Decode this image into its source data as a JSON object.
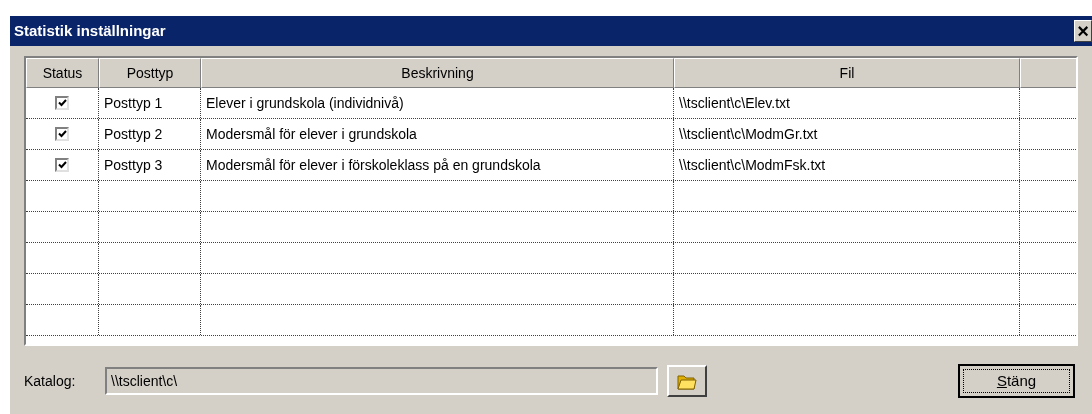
{
  "window": {
    "title": "Statistik inställningar",
    "close": "×"
  },
  "table": {
    "columns": [
      "Status",
      "Posttyp",
      "Beskrivning",
      "Fil"
    ],
    "rows": [
      {
        "checked": true,
        "posttyp": "Posttyp 1",
        "beskrivning": "Elever i grundskola (individnivå)",
        "fil": "\\\\tsclient\\c\\Elev.txt"
      },
      {
        "checked": true,
        "posttyp": "Posttyp 2",
        "beskrivning": "Modersmål för elever i grundskola",
        "fil": "\\\\tsclient\\c\\ModmGr.txt"
      },
      {
        "checked": true,
        "posttyp": "Posttyp 3",
        "beskrivning": "Modersmål för elever i förskoleklass på en grundskola",
        "fil": "\\\\tsclient\\c\\ModmFsk.txt"
      }
    ]
  },
  "katalog": {
    "label": "Katalog:",
    "value": "\\\\tsclient\\c\\"
  },
  "buttons": [
    "Stäng"
  ]
}
